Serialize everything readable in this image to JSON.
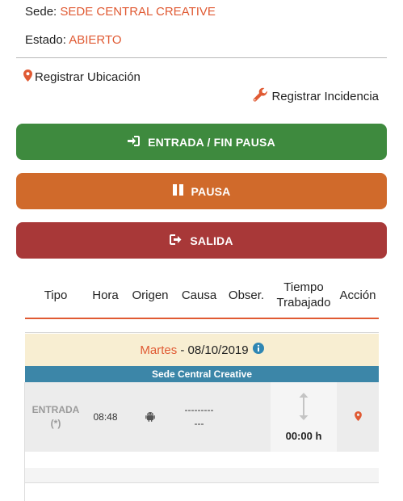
{
  "info": {
    "sede_label": "Sede:",
    "sede_value": "SEDE CENTRAL CREATIVE",
    "estado_label": "Estado:",
    "estado_value": "ABIERTO"
  },
  "links": {
    "registrar_ubicacion": "Registrar Ubicación",
    "registrar_incidencia": "Registrar Incidencia"
  },
  "buttons": {
    "entrada": "ENTRADA / FIN PAUSA",
    "pausa": "PAUSA",
    "salida": "SALIDA"
  },
  "table": {
    "headers": {
      "tipo": "Tipo",
      "hora": "Hora",
      "origen": "Origen",
      "causa": "Causa",
      "obser": "Obser.",
      "tiempo_1": "Tiempo",
      "tiempo_2": "Trabajado",
      "accion": "Acción"
    },
    "day": {
      "name": "Martes",
      "separator": " - ",
      "date": "08/10/2019"
    },
    "sede": "Sede Central Creative",
    "row": {
      "tipo": "ENTRADA",
      "tipo_note": "(*)",
      "hora": "08:48",
      "origen_icon": "android-icon",
      "causa_1": "---------",
      "causa_2": "---",
      "tiempo": "00:00 h"
    }
  },
  "colors": {
    "accent": "#e05a33",
    "green": "#3e8a3e",
    "orange": "#d06a2b",
    "red": "#a83838",
    "blue": "#3c86a8"
  }
}
